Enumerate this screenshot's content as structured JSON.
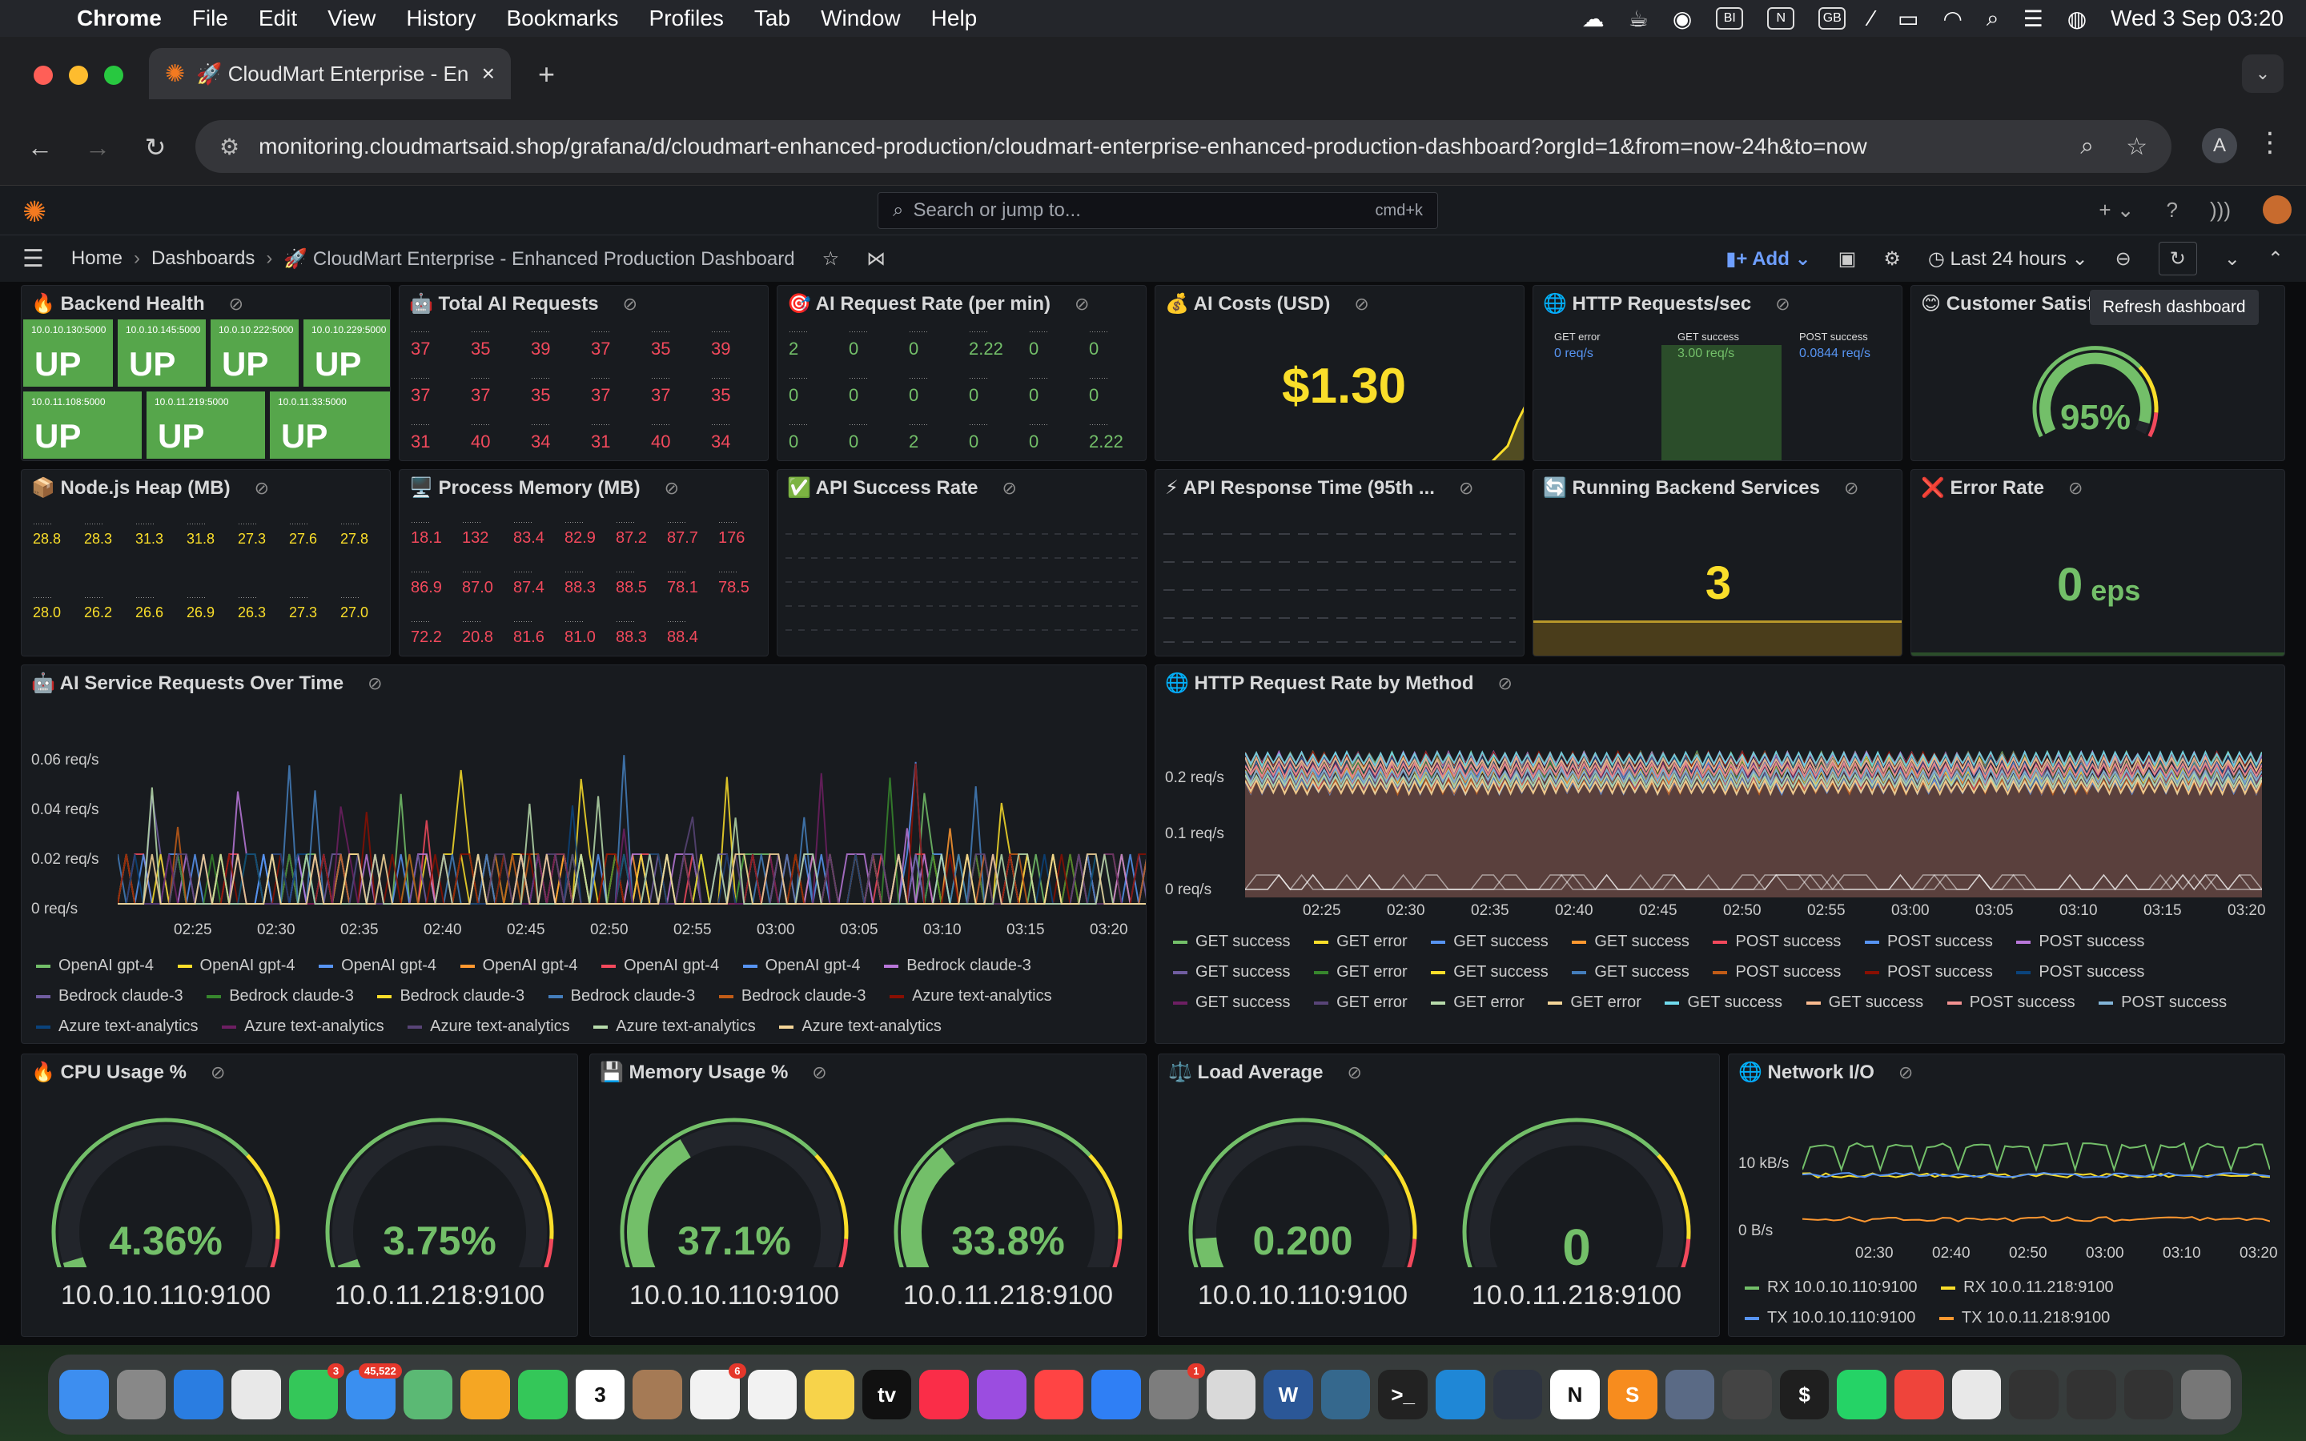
{
  "menubar": {
    "app": "Chrome",
    "items": [
      "File",
      "Edit",
      "View",
      "History",
      "Bookmarks",
      "Profiles",
      "Tab",
      "Window",
      "Help"
    ],
    "status_icons": [
      "weather-icon",
      "tea-icon",
      "chrome-icon",
      "BI",
      "N",
      "GB",
      "mute-icon",
      "battery-icon",
      "wifi-icon",
      "search-icon",
      "control-center-icon",
      "siri-icon"
    ],
    "datetime": "Wed 3 Sep  03:20"
  },
  "browser": {
    "tab_title": "🚀 CloudMart Enterprise - En",
    "url": "monitoring.cloudmartsaid.shop/grafana/d/cloudmart-enhanced-production/cloudmart-enterprise-enhanced-production-dashboard?orgId=1&from=now-24h&to=now",
    "profile_initial": "A"
  },
  "grafana": {
    "search_placeholder": "Search or jump to...",
    "search_shortcut": "cmd+k",
    "breadcrumb": [
      "Home",
      "Dashboards",
      "🚀 CloudMart Enterprise - Enhanced Production Dashboard"
    ],
    "add_label": "Add",
    "time_range": "Last 24 hours",
    "tooltip": "Refresh dashboard"
  },
  "panels": {
    "backend_health": {
      "title": "🔥 Backend Health",
      "instances": [
        {
          "name": "10.0.10.130:5000",
          "value": "UP"
        },
        {
          "name": "10.0.10.145:5000",
          "value": "UP"
        },
        {
          "name": "10.0.10.222:5000",
          "value": "UP"
        },
        {
          "name": "10.0.10.229:5000",
          "value": "UP"
        },
        {
          "name": "10.0.11.108:5000",
          "value": "UP"
        },
        {
          "name": "10.0.11.219:5000",
          "value": "UP"
        },
        {
          "name": "10.0.11.33:5000",
          "value": "UP"
        }
      ]
    },
    "total_ai_requests": {
      "title": "🤖 Total AI Requests",
      "values": [
        "37",
        "35",
        "39",
        "37",
        "35",
        "39",
        "37",
        "37",
        "35",
        "37",
        "37",
        "35",
        "31",
        "40",
        "34",
        "31",
        "40",
        "34"
      ]
    },
    "ai_request_rate": {
      "title": "🎯 AI Request Rate (per min)",
      "values": [
        "2",
        "0",
        "0",
        "2.22",
        "0",
        "0",
        "0",
        "0",
        "0",
        "0",
        "0",
        "0",
        "0",
        "0",
        "2",
        "0",
        "0",
        "2.22"
      ]
    },
    "ai_costs": {
      "title": "💰 AI Costs (USD)",
      "value": "$1.30"
    },
    "http_requests": {
      "title": "🌐 HTTP Requests/sec",
      "series": [
        {
          "name": "GET error",
          "value": "0 req/s"
        },
        {
          "name": "GET success",
          "value": "3.00 req/s"
        },
        {
          "name": "POST success",
          "value": "0.0844 req/s"
        }
      ]
    },
    "customer_satisfaction": {
      "title": "😊 Customer Satisfac",
      "value": "95%",
      "gauge_fraction": 0.95
    },
    "nodejs_heap": {
      "title": "📦 Node.js Heap (MB)",
      "values": [
        "28.8",
        "28.3",
        "31.3",
        "31.8",
        "27.3",
        "27.6",
        "27.8",
        "28.0",
        "26.2",
        "26.6",
        "26.9",
        "26.3",
        "27.3",
        "27.0"
      ]
    },
    "process_memory": {
      "title": "🖥️ Process Memory (MB)",
      "values": [
        "18.1",
        "132",
        "83.4",
        "82.9",
        "87.2",
        "87.7",
        "176",
        "86.9",
        "87.0",
        "87.4",
        "88.3",
        "88.5",
        "78.1",
        "78.5",
        "72.2",
        "20.8",
        "81.6",
        "81.0",
        "88.3",
        "88.4"
      ]
    },
    "api_success_rate": {
      "title": "✅ API Success Rate"
    },
    "api_response_time": {
      "title": "⚡ API Response Time (95th ..."
    },
    "running_services": {
      "title": "🔄 Running Backend Services",
      "value": "3"
    },
    "error_rate": {
      "title": "❌ Error Rate",
      "value": "0",
      "unit": "eps"
    },
    "ai_requests_over_time": {
      "title": "🤖 AI Service Requests Over Time",
      "y_ticks": [
        "0.06 req/s",
        "0.04 req/s",
        "0.02 req/s",
        "0 req/s"
      ],
      "x_ticks": [
        "02:25",
        "02:30",
        "02:35",
        "02:40",
        "02:45",
        "02:50",
        "02:55",
        "03:00",
        "03:05",
        "03:10",
        "03:15",
        "03:20"
      ],
      "legend": [
        {
          "name": "OpenAI gpt-4",
          "color": "#73bf69"
        },
        {
          "name": "OpenAI gpt-4",
          "color": "#fade2a"
        },
        {
          "name": "OpenAI gpt-4",
          "color": "#5794f2"
        },
        {
          "name": "OpenAI gpt-4",
          "color": "#ff9830"
        },
        {
          "name": "OpenAI gpt-4",
          "color": "#f2495c"
        },
        {
          "name": "OpenAI gpt-4",
          "color": "#5794f2"
        },
        {
          "name": "Bedrock claude-3",
          "color": "#b877d9"
        },
        {
          "name": "Bedrock claude-3",
          "color": "#705da0"
        },
        {
          "name": "Bedrock claude-3",
          "color": "#37872d"
        },
        {
          "name": "Bedrock claude-3",
          "color": "#fade2a"
        },
        {
          "name": "Bedrock claude-3",
          "color": "#447ebc"
        },
        {
          "name": "Bedrock claude-3",
          "color": "#c15c17"
        },
        {
          "name": "Azure text-analytics",
          "color": "#890f02"
        },
        {
          "name": "Azure text-analytics",
          "color": "#0a437c"
        },
        {
          "name": "Azure text-analytics",
          "color": "#6d1f62"
        },
        {
          "name": "Azure text-analytics",
          "color": "#584477"
        },
        {
          "name": "Azure text-analytics",
          "color": "#b7dbab"
        },
        {
          "name": "Azure text-analytics",
          "color": "#f4d598"
        }
      ]
    },
    "http_by_method": {
      "title": "🌐 HTTP Request Rate by Method",
      "y_ticks": [
        "0.2 req/s",
        "0.1 req/s",
        "0 req/s"
      ],
      "x_ticks": [
        "02:25",
        "02:30",
        "02:35",
        "02:40",
        "02:45",
        "02:50",
        "02:55",
        "03:00",
        "03:05",
        "03:10",
        "03:15",
        "03:20"
      ],
      "legend": [
        {
          "name": "GET success",
          "color": "#73bf69"
        },
        {
          "name": "GET error",
          "color": "#fade2a"
        },
        {
          "name": "GET success",
          "color": "#5794f2"
        },
        {
          "name": "GET success",
          "color": "#ff9830"
        },
        {
          "name": "POST success",
          "color": "#f2495c"
        },
        {
          "name": "POST success",
          "color": "#5794f2"
        },
        {
          "name": "POST success",
          "color": "#b877d9"
        },
        {
          "name": "GET success",
          "color": "#705da0"
        },
        {
          "name": "GET error",
          "color": "#37872d"
        },
        {
          "name": "GET success",
          "color": "#fade2a"
        },
        {
          "name": "GET success",
          "color": "#447ebc"
        },
        {
          "name": "POST success",
          "color": "#c15c17"
        },
        {
          "name": "POST success",
          "color": "#890f02"
        },
        {
          "name": "POST success",
          "color": "#0a437c"
        },
        {
          "name": "GET success",
          "color": "#6d1f62"
        },
        {
          "name": "GET error",
          "color": "#584477"
        },
        {
          "name": "GET error",
          "color": "#b7dbab"
        },
        {
          "name": "GET error",
          "color": "#f4d598"
        },
        {
          "name": "GET success",
          "color": "#70dbed"
        },
        {
          "name": "GET success",
          "color": "#f9ba8f"
        },
        {
          "name": "POST success",
          "color": "#f29191"
        },
        {
          "name": "POST success",
          "color": "#82b5d8"
        }
      ]
    },
    "cpu_usage": {
      "title": "🔥 CPU Usage %",
      "gauges": [
        {
          "value": "4.36%",
          "name": "10.0.10.110:9100",
          "fraction": 0.0436
        },
        {
          "value": "3.75%",
          "name": "10.0.11.218:9100",
          "fraction": 0.0375
        }
      ]
    },
    "memory_usage": {
      "title": "💾 Memory Usage %",
      "gauges": [
        {
          "value": "37.1%",
          "name": "10.0.10.110:9100",
          "fraction": 0.371
        },
        {
          "value": "33.8%",
          "name": "10.0.11.218:9100",
          "fraction": 0.338
        }
      ]
    },
    "load_average": {
      "title": "⚖️ Load Average",
      "gauges": [
        {
          "value": "0.200",
          "name": "10.0.10.110:9100",
          "fraction": 0.1
        },
        {
          "value": "0",
          "name": "10.0.11.218:9100",
          "fraction": 0
        }
      ]
    },
    "network_io": {
      "title": "🌐 Network I/O",
      "y_ticks": [
        "10 kB/s",
        "0 B/s"
      ],
      "x_ticks": [
        "02:30",
        "02:40",
        "02:50",
        "03:00",
        "03:10",
        "03:20"
      ],
      "legend": [
        {
          "name": "RX 10.0.10.110:9100",
          "color": "#73bf69"
        },
        {
          "name": "RX 10.0.11.218:9100",
          "color": "#fade2a"
        },
        {
          "name": "TX 10.0.10.110:9100",
          "color": "#5794f2"
        },
        {
          "name": "TX 10.0.11.218:9100",
          "color": "#ff9830"
        }
      ]
    }
  },
  "dock": {
    "apps": [
      {
        "name": "finder",
        "color": "#3d8ef0",
        "label": ""
      },
      {
        "name": "launchpad",
        "color": "#888",
        "label": ""
      },
      {
        "name": "safari",
        "color": "#2a7de1",
        "label": ""
      },
      {
        "name": "chrome",
        "color": "#e8e8e8",
        "label": ""
      },
      {
        "name": "messages",
        "color": "#34c759",
        "label": "",
        "badge": "3"
      },
      {
        "name": "mail",
        "color": "#3a8ff0",
        "label": "",
        "badge": "45,522"
      },
      {
        "name": "maps",
        "color": "#5bb974",
        "label": ""
      },
      {
        "name": "photos",
        "color": "#f5a623",
        "label": ""
      },
      {
        "name": "facetime",
        "color": "#34c759",
        "label": ""
      },
      {
        "name": "calendar",
        "color": "#ffffff",
        "label": "3"
      },
      {
        "name": "contacts",
        "color": "#a57a55",
        "label": ""
      },
      {
        "name": "reminders",
        "color": "#f2f2f2",
        "label": "",
        "badge": "6"
      },
      {
        "name": "freeform",
        "color": "#f2f2f2",
        "label": ""
      },
      {
        "name": "notes",
        "color": "#f7d34a",
        "label": ""
      },
      {
        "name": "tv",
        "color": "#111",
        "label": "tv"
      },
      {
        "name": "music",
        "color": "#fa2d48",
        "label": ""
      },
      {
        "name": "podcasts",
        "color": "#9b4de0",
        "label": ""
      },
      {
        "name": "news",
        "color": "#f44",
        "label": ""
      },
      {
        "name": "app-store",
        "color": "#2f7ff5",
        "label": ""
      },
      {
        "name": "system-settings",
        "color": "#7d7d7d",
        "label": "",
        "badge": "1"
      },
      {
        "name": "preview",
        "color": "#d9d9d9",
        "label": ""
      },
      {
        "name": "word",
        "color": "#2b5797",
        "label": "W"
      },
      {
        "name": "mysql-workbench",
        "color": "#35688d",
        "label": ""
      },
      {
        "name": "terminal",
        "color": "#222",
        "label": ">_"
      },
      {
        "name": "vscode",
        "color": "#1f87d6",
        "label": ""
      },
      {
        "name": "electron",
        "color": "#2e3440",
        "label": ""
      },
      {
        "name": "notion",
        "color": "#fff",
        "label": "N"
      },
      {
        "name": "sublime",
        "color": "#f78c1e",
        "label": "S"
      },
      {
        "name": "finder-window",
        "color": "#5a6a85",
        "label": ""
      },
      {
        "name": "tunnel",
        "color": "#444",
        "label": ""
      },
      {
        "name": "console",
        "color": "#1f1f1f",
        "label": "$"
      },
      {
        "name": "whatsapp",
        "color": "#25d366",
        "label": ""
      },
      {
        "name": "anydesk",
        "color": "#ef443b",
        "label": ""
      },
      {
        "name": "textedit",
        "color": "#e8e8e8",
        "label": ""
      },
      {
        "name": "window-1",
        "color": "#333",
        "label": ""
      },
      {
        "name": "window-2",
        "color": "#333",
        "label": ""
      },
      {
        "name": "window-3",
        "color": "#333",
        "label": ""
      },
      {
        "name": "trash",
        "color": "#777",
        "label": ""
      }
    ]
  }
}
